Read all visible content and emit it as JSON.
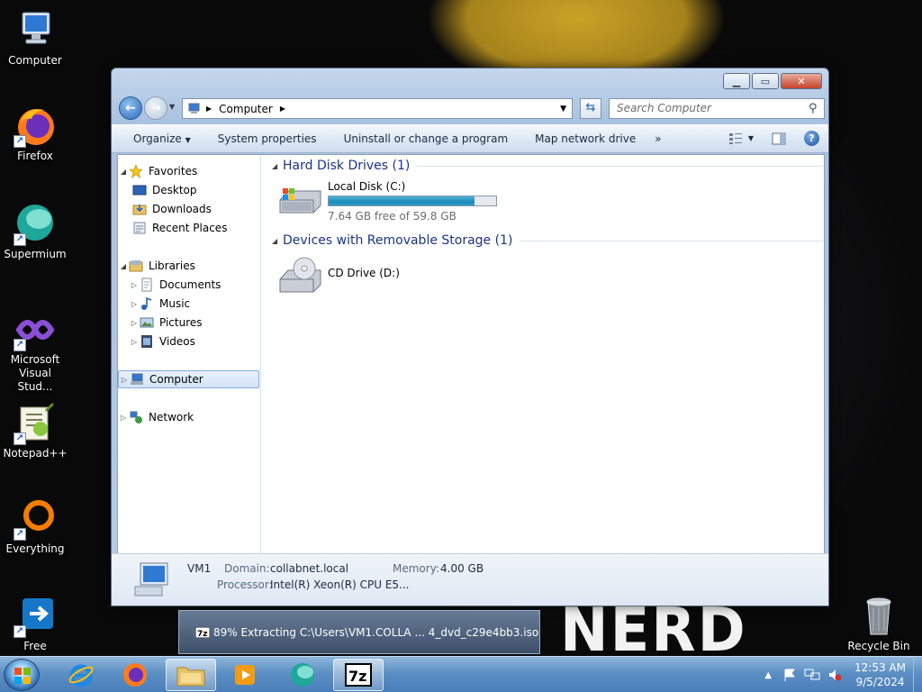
{
  "desktop": {
    "icons": [
      {
        "label": "Computer"
      },
      {
        "label": "Firefox"
      },
      {
        "label": "Supermium"
      },
      {
        "label": "Microsoft Visual Stud..."
      },
      {
        "label": "Notepad++"
      },
      {
        "label": "Everything"
      },
      {
        "label": "Free"
      },
      {
        "label": "Recycle Bin"
      }
    ],
    "wallpaper_text": "NERD"
  },
  "window": {
    "address": {
      "root_label": "Computer"
    },
    "search": {
      "placeholder": "Search Computer"
    },
    "toolbar": {
      "organize": "Organize",
      "system_properties": "System properties",
      "uninstall": "Uninstall or change a program",
      "map_network": "Map network drive",
      "more": "»"
    },
    "nav": {
      "favorites": "Favorites",
      "desktop": "Desktop",
      "downloads": "Downloads",
      "recent_places": "Recent Places",
      "libraries": "Libraries",
      "documents": "Documents",
      "music": "Music",
      "pictures": "Pictures",
      "videos": "Videos",
      "computer": "Computer",
      "network": "Network"
    },
    "groups": {
      "hdd": "Hard Disk Drives (1)",
      "removable": "Devices with Removable Storage (1)"
    },
    "drives": {
      "c": {
        "name": "Local Disk (C:)",
        "free": "7.64 GB free of 59.8 GB",
        "used_fraction": 0.872
      },
      "d": {
        "name": "CD Drive (D:)"
      }
    },
    "details": {
      "name": "VM1",
      "domain_label": "Domain:",
      "domain_value": "collabnet.local",
      "memory_label": "Memory:",
      "memory_value": "4.00 GB",
      "processor_label": "Processor:",
      "processor_value": "Intel(R) Xeon(R) CPU E5..."
    }
  },
  "popup": {
    "text": "89% Extracting C:\\Users\\VM1.COLLA ... 4_dvd_c29e4bb3.iso"
  },
  "taskbar": {
    "clock_time": "12:53 AM",
    "clock_date": "9/5/2024"
  },
  "colors": {
    "accent": "#1e3287",
    "taskbar": "#5c8fc4",
    "progress": "#1c8ab6"
  }
}
